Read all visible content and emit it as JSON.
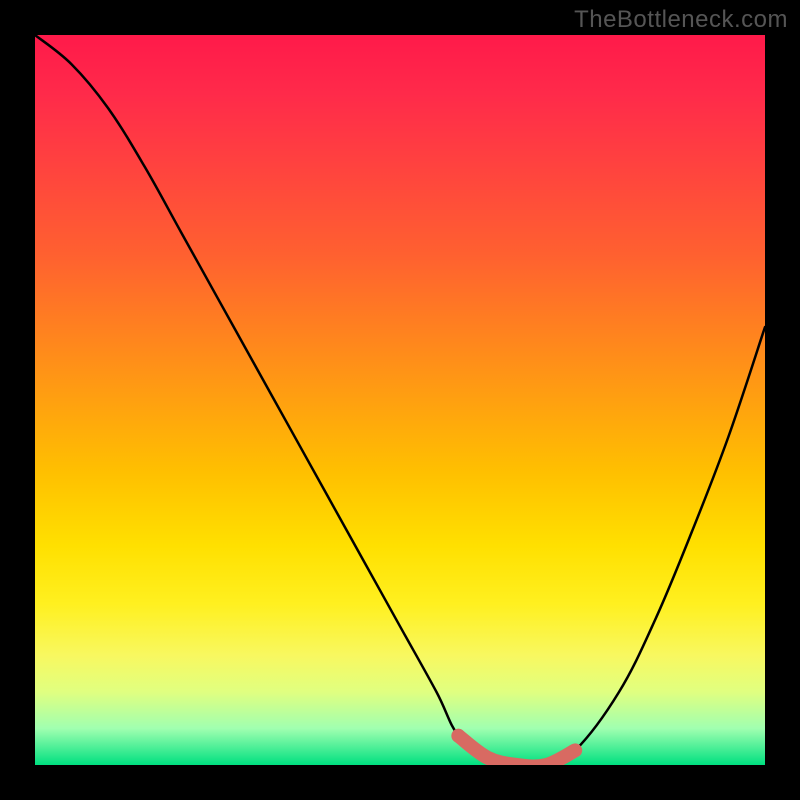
{
  "watermark": "TheBottleneck.com",
  "chart_data": {
    "type": "line",
    "title": "",
    "xlabel": "",
    "ylabel": "",
    "xlim": [
      0,
      100
    ],
    "ylim": [
      0,
      100
    ],
    "series": [
      {
        "name": "bottleneck-curve",
        "x": [
          0,
          5,
          10,
          15,
          20,
          25,
          30,
          35,
          40,
          45,
          50,
          55,
          58,
          62,
          66,
          70,
          74,
          80,
          85,
          90,
          95,
          100
        ],
        "values": [
          100,
          96,
          90,
          82,
          73,
          64,
          55,
          46,
          37,
          28,
          19,
          10,
          4,
          1,
          0,
          0,
          2,
          10,
          20,
          32,
          45,
          60
        ]
      }
    ],
    "highlight": {
      "name": "optimal-range",
      "x": [
        58,
        62,
        66,
        70,
        74
      ],
      "values": [
        4,
        1,
        0,
        0,
        2
      ]
    },
    "gradient_stops": [
      {
        "pos": 0,
        "color": "#ff1a4a"
      },
      {
        "pos": 50,
        "color": "#ffc000"
      },
      {
        "pos": 100,
        "color": "#00e080"
      }
    ]
  }
}
